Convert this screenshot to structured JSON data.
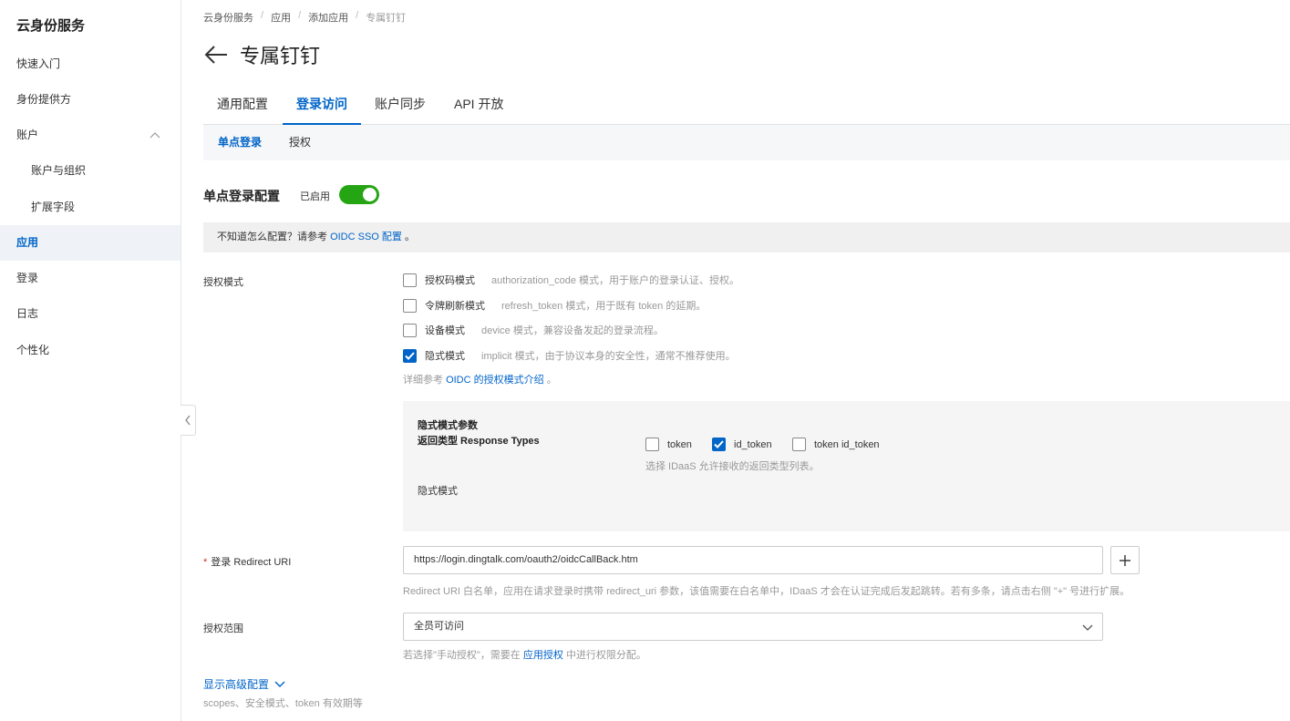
{
  "sidebar": {
    "brand": "云身份服务",
    "items": [
      {
        "label": "快速入门"
      },
      {
        "label": "身份提供方"
      },
      {
        "label": "账户"
      },
      {
        "label": "账户与组织"
      },
      {
        "label": "扩展字段"
      },
      {
        "label": "应用"
      },
      {
        "label": "登录"
      },
      {
        "label": "日志"
      },
      {
        "label": "个性化"
      }
    ],
    "collapse_icon": "chevron-left"
  },
  "breadcrumb": [
    "云身份服务",
    "应用",
    "添加应用",
    "专属钉钉"
  ],
  "page_title": "专属钉钉",
  "tabs": [
    {
      "label": "通用配置"
    },
    {
      "label": "登录访问"
    },
    {
      "label": "账户同步"
    },
    {
      "label": "API 开放"
    }
  ],
  "subtabs": [
    {
      "label": "单点登录"
    },
    {
      "label": "授权"
    }
  ],
  "sso": {
    "title": "单点登录配置",
    "status": "已启用",
    "enabled": true
  },
  "tip": {
    "prefix": "不知道怎么配置？请参考",
    "link": "OIDC SSO 配置",
    "suffix": "。"
  },
  "grant_mode": {
    "label": "授权模式",
    "options": [
      {
        "label": "授权码模式",
        "desc": "authorization_code 模式，用于账户的登录认证、授权。",
        "checked": false
      },
      {
        "label": "令牌刷新模式",
        "desc": "refresh_token 模式，用于既有 token 的延期。",
        "checked": false
      },
      {
        "label": "设备模式",
        "desc": "device 模式，兼容设备发起的登录流程。",
        "checked": false
      },
      {
        "label": "隐式模式",
        "desc": "implicit 模式，由于协议本身的安全性，通常不推荐使用。",
        "checked": true
      }
    ],
    "ref_prefix": "详细参考",
    "ref_link": "OIDC 的授权模式介绍",
    "ref_suffix": "。"
  },
  "implicit_params": {
    "title": "隐式模式参数",
    "response_types_label": "返回类型 Response Types",
    "response_types": [
      {
        "label": "token",
        "checked": false
      },
      {
        "label": "id_token",
        "checked": true
      },
      {
        "label": "token id_token",
        "checked": false
      }
    ],
    "response_types_hint": "选择 IDaaS 允许接收的返回类型列表。",
    "mode_label": "隐式模式"
  },
  "redirect": {
    "label": "登录 Redirect URI",
    "required_mark": "*",
    "value": "https://login.dingtalk.com/oauth2/oidcCallBack.htm",
    "hint": "Redirect URI 白名单，应用在请求登录时携带 redirect_uri 参数，该值需要在白名单中，IDaaS 才会在认证完成后发起跳转。若有多条，请点击右侧 \"+\" 号进行扩展。"
  },
  "scope": {
    "label": "授权范围",
    "value": "全员可访问",
    "hint_prefix": "若选择\"手动授权\"，需要在",
    "hint_link": "应用授权",
    "hint_suffix": "中进行权限分配。"
  },
  "advanced": {
    "label": "显示高级配置",
    "desc": "scopes、安全模式、token 有效期等"
  },
  "colors": {
    "accent": "#0064c8",
    "toggle_on": "#26a514",
    "required": "#d93026"
  }
}
